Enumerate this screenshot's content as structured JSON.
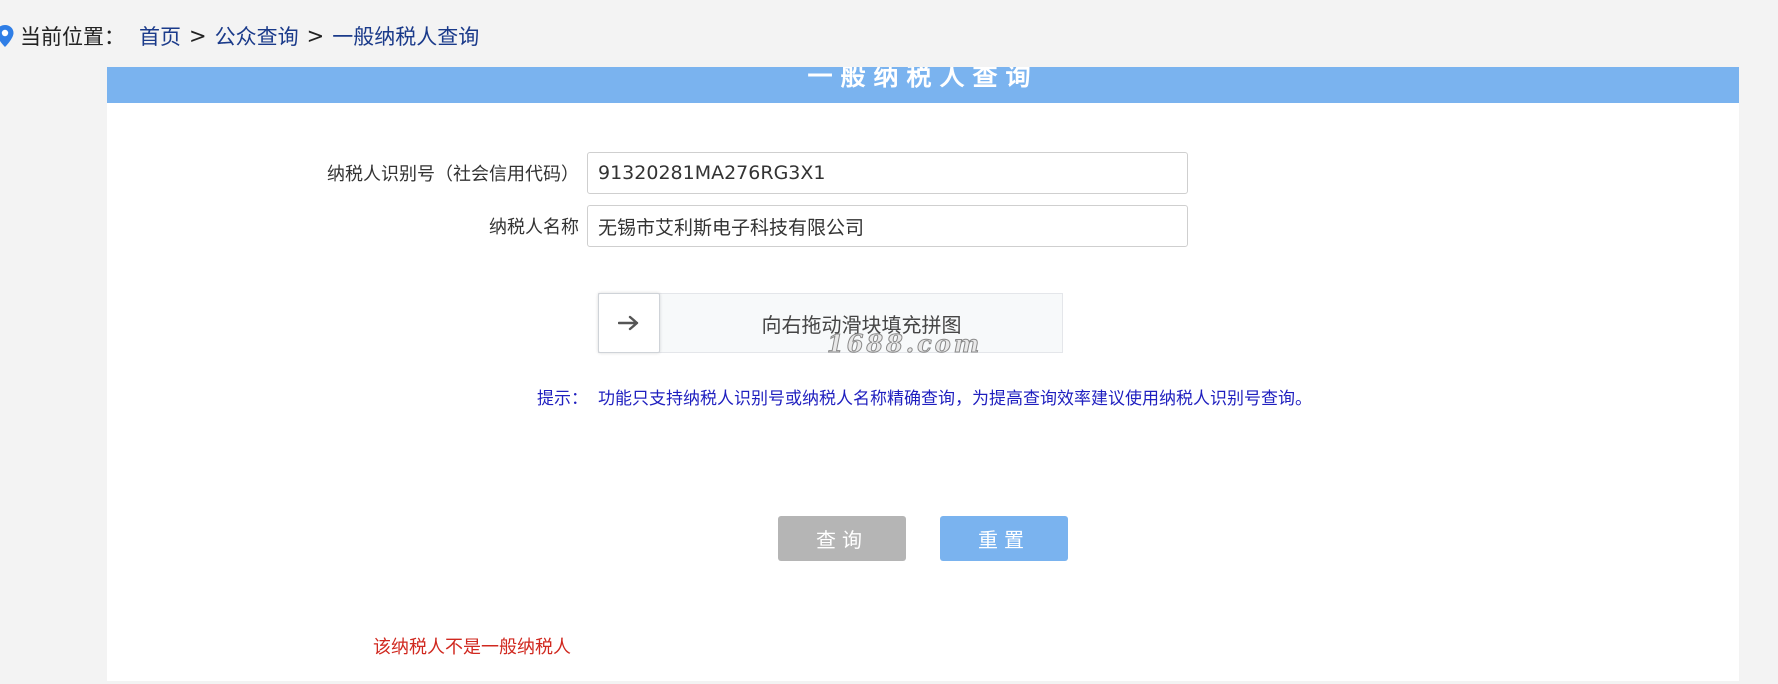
{
  "breadcrumb": {
    "label": "当前位置：",
    "items": [
      "首页",
      "公众查询",
      "一般纳税人查询"
    ],
    "separator": ">"
  },
  "panel": {
    "title": "一般纳税人查询"
  },
  "form": {
    "taxpayer_id": {
      "label": "纳税人识别号（社会信用代码）",
      "value": "91320281MA276RG3X1"
    },
    "taxpayer_name": {
      "label": "纳税人名称",
      "value": "无锡市艾利斯电子科技有限公司"
    }
  },
  "slider": {
    "handle_icon": "arrow-right-icon",
    "text": "向右拖动滑块填充拼图",
    "watermark": "1688.com",
    "progress": 0
  },
  "tip": {
    "label": "提示：",
    "text": "功能只支持纳税人识别号或纳税人名称精确查询，为提高查询效率建议使用纳税人识别号查询。"
  },
  "buttons": {
    "query": "查询",
    "reset": "重置"
  },
  "result": {
    "message": "该纳税人不是一般纳税人"
  },
  "colors": {
    "accent": "#7ab3ef",
    "tip": "#1f1fbf",
    "error": "#d0281f",
    "disabled_button": "#b5b5b5"
  }
}
